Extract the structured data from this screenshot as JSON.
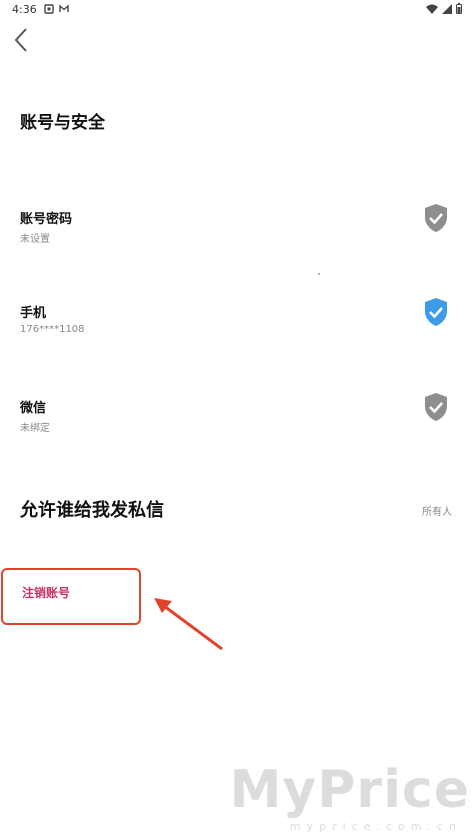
{
  "status_bar": {
    "time": "4:36"
  },
  "header": {
    "title": "账号与安全"
  },
  "items": [
    {
      "title": "账号密码",
      "subtitle": "未设置",
      "status": "unverified"
    },
    {
      "title": "手机",
      "subtitle": "176****1108",
      "status": "verified"
    },
    {
      "title": "微信",
      "subtitle": "未绑定",
      "status": "unverified"
    }
  ],
  "dm_setting": {
    "label": "允许谁给我发私信",
    "value": "所有人"
  },
  "cancel_account": {
    "label": "注销账号"
  },
  "watermark": {
    "main": "MyPrice",
    "sub": "myprice.com.cn"
  },
  "colors": {
    "verified": "#3d9be9",
    "unverified": "#8e8e8e",
    "cancel": "#c8336a",
    "highlight": "#e0442c"
  }
}
